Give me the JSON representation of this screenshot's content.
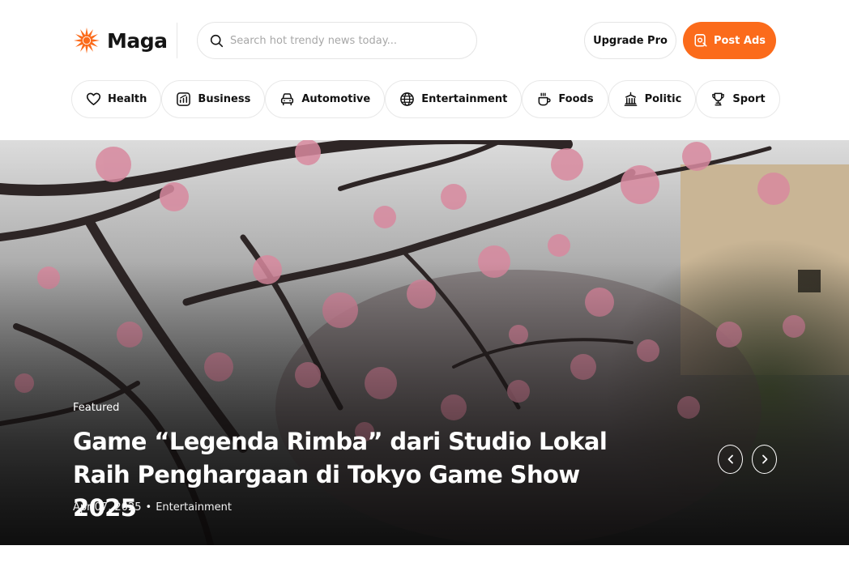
{
  "header": {
    "logo_text": "Maga",
    "search": {
      "placeholder": "Search hot trendy news today..."
    },
    "upgrade_label": "Upgrade Pro",
    "post_ads_label": "Post Ads"
  },
  "categories": [
    {
      "label": "Health",
      "icon": "heart-icon"
    },
    {
      "label": "Business",
      "icon": "chart-icon"
    },
    {
      "label": "Automotive",
      "icon": "car-icon"
    },
    {
      "label": "Entertainment",
      "icon": "globe-icon"
    },
    {
      "label": "Foods",
      "icon": "cup-icon"
    },
    {
      "label": "Politic",
      "icon": "building-icon"
    },
    {
      "label": "Sport",
      "icon": "trophy-icon"
    }
  ],
  "hero": {
    "tag": "Featured",
    "title": "Game “Legenda Rimba” dari Studio Lokal Raih Penghargaan di Tokyo Game Show 2025",
    "date": "Apr 07, 2025",
    "separator": "•",
    "category": "Entertainment"
  },
  "colors": {
    "accent": "#fb6b1b",
    "text": "#111111",
    "border": "#e5e5e5"
  }
}
